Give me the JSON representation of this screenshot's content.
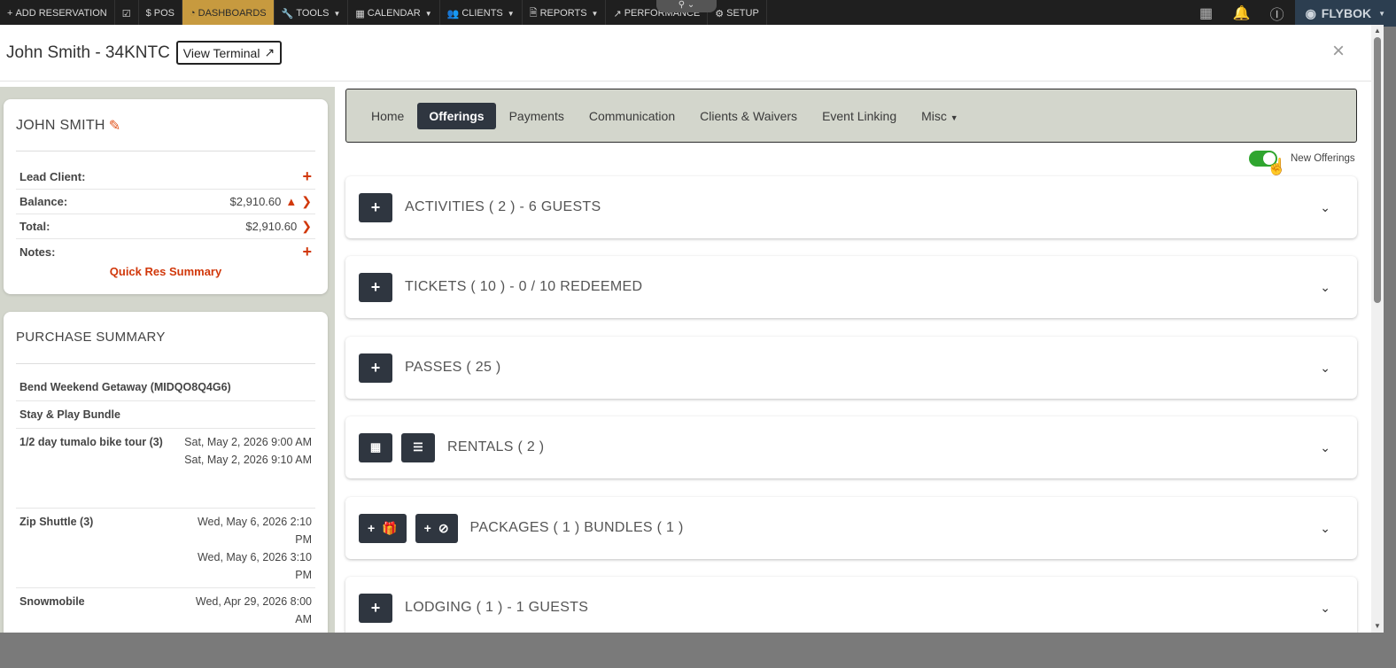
{
  "topnav": {
    "items": [
      {
        "icon": "plus-icon",
        "label": "ADD RESERVATION"
      },
      {
        "icon": "check-square-icon",
        "label": ""
      },
      {
        "icon": "dollar-icon",
        "label": "POS"
      },
      {
        "icon": "dashboard-icon",
        "label": "DASHBOARDS"
      },
      {
        "icon": "wrench-icon",
        "label": "TOOLS"
      },
      {
        "icon": "calendar-icon",
        "label": "CALENDAR"
      },
      {
        "icon": "users-icon",
        "label": "CLIENTS"
      },
      {
        "icon": "file-icon",
        "label": "REPORTS"
      },
      {
        "icon": "line-chart-icon",
        "label": "PERFORMANCE"
      },
      {
        "icon": "gear-icon",
        "label": "SETUP"
      }
    ],
    "brand": "FLYBOK"
  },
  "modal": {
    "title": "John Smith - 34KNTC",
    "view_terminal": "View Terminal"
  },
  "client_card": {
    "name": "JOHN SMITH",
    "rows": [
      {
        "label": "Lead Client:",
        "value": ""
      },
      {
        "label": "Balance:",
        "value": "$2,910.60"
      },
      {
        "label": "Total:",
        "value": "$2,910.60"
      },
      {
        "label": "Notes:",
        "value": ""
      }
    ],
    "quick_res": "Quick Res Summary"
  },
  "purchase_summary": {
    "title": "PURCHASE SUMMARY",
    "items": [
      {
        "name": "Bend Weekend Getaway (MIDQO8Q4G6)",
        "dates": []
      },
      {
        "name": "Stay & Play Bundle",
        "dates": []
      },
      {
        "name": "1/2 day tumalo bike tour (3)",
        "dates": [
          "Sat, May 2, 2026 9:00 AM",
          "Sat, May 2, 2026 9:10 AM"
        ]
      },
      {
        "name": "Zip Shuttle (3)",
        "dates": [
          "Wed, May 6, 2026 2:10 PM",
          "Wed, May 6, 2026 3:10 PM"
        ]
      },
      {
        "name": "Snowmobile",
        "dates": [
          "Wed, Apr 29, 2026 8:00 AM"
        ]
      }
    ]
  },
  "tabs": [
    "Home",
    "Offerings",
    "Payments",
    "Communication",
    "Clients & Waivers",
    "Event Linking",
    "Misc"
  ],
  "toggle": {
    "label": "New Offerings",
    "on": true
  },
  "sections": [
    {
      "title": "ACTIVITIES ( 2 ) - 6 GUESTS"
    },
    {
      "title": "TICKETS ( 10 ) - 0 / 10 REDEEMED"
    },
    {
      "title": "PASSES ( 25 )"
    },
    {
      "title": "RENTALS ( 2 )"
    },
    {
      "title": "PACKAGES ( 1 ) BUNDLES ( 1 )"
    },
    {
      "title": "LODGING ( 1 ) - 1 GUESTS"
    }
  ],
  "colors": {
    "accent": "#d1380b",
    "dark": "#2f3640",
    "toggle_on": "#2fa52f",
    "tabs_bg": "#d3d6cc",
    "active_nav": "#c79a3f"
  }
}
